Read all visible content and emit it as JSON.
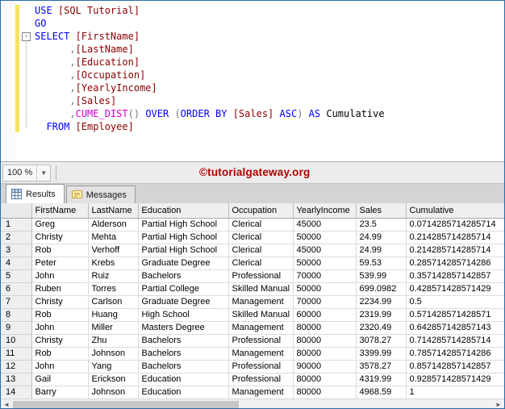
{
  "editor": {
    "token_colors": {
      "kw": "#0000ff",
      "id": "#8b0000",
      "fn": "#d400d4",
      "op": "#777777",
      "pl": "#000000"
    },
    "collapse_glyph": "-",
    "lines": [
      [
        {
          "t": "USE ",
          "c": "kw"
        },
        {
          "t": "[SQL Tutorial]",
          "c": "id"
        }
      ],
      [
        {
          "t": "GO",
          "c": "kw"
        }
      ],
      [
        {
          "t": "SELECT ",
          "c": "kw"
        },
        {
          "t": "[FirstName]",
          "c": "id"
        }
      ],
      [
        {
          "t": "      ",
          "c": "pl"
        },
        {
          "t": ",",
          "c": "op"
        },
        {
          "t": "[LastName]",
          "c": "id"
        }
      ],
      [
        {
          "t": "      ",
          "c": "pl"
        },
        {
          "t": ",",
          "c": "op"
        },
        {
          "t": "[Education]",
          "c": "id"
        }
      ],
      [
        {
          "t": "      ",
          "c": "pl"
        },
        {
          "t": ",",
          "c": "op"
        },
        {
          "t": "[Occupation]",
          "c": "id"
        }
      ],
      [
        {
          "t": "      ",
          "c": "pl"
        },
        {
          "t": ",",
          "c": "op"
        },
        {
          "t": "[YearlyIncome]",
          "c": "id"
        }
      ],
      [
        {
          "t": "      ",
          "c": "pl"
        },
        {
          "t": ",",
          "c": "op"
        },
        {
          "t": "[Sales]",
          "c": "id"
        }
      ],
      [
        {
          "t": "      ",
          "c": "pl"
        },
        {
          "t": ",",
          "c": "op"
        },
        {
          "t": "CUME_DIST",
          "c": "fn"
        },
        {
          "t": "()",
          "c": "op"
        },
        {
          "t": " ",
          "c": "pl"
        },
        {
          "t": "OVER ",
          "c": "kw"
        },
        {
          "t": "(",
          "c": "op"
        },
        {
          "t": "ORDER BY ",
          "c": "kw"
        },
        {
          "t": "[Sales]",
          "c": "id"
        },
        {
          "t": " ",
          "c": "pl"
        },
        {
          "t": "ASC",
          "c": "kw"
        },
        {
          "t": ")",
          "c": "op"
        },
        {
          "t": " ",
          "c": "pl"
        },
        {
          "t": "AS ",
          "c": "kw"
        },
        {
          "t": "Cumulative",
          "c": "pl"
        }
      ],
      [
        {
          "t": "  ",
          "c": "pl"
        },
        {
          "t": "FROM ",
          "c": "kw"
        },
        {
          "t": "[Employee]",
          "c": "id"
        }
      ]
    ]
  },
  "statusbar": {
    "zoom_value": "100 %",
    "dropdown_arrow": "▼"
  },
  "watermark": {
    "text": "©tutorialgateway.org",
    "color": "#b20000"
  },
  "results_pane": {
    "tabs": [
      {
        "label": "Results",
        "active": true
      },
      {
        "label": "Messages",
        "active": false
      }
    ],
    "grid": {
      "columns": [
        "FirstName",
        "LastName",
        "Education",
        "Occupation",
        "YearlyIncome",
        "Sales",
        "Cumulative"
      ],
      "rows": [
        [
          "Greg",
          "Alderson",
          "Partial High School",
          "Clerical",
          "45000",
          "23.5",
          "0.0714285714285714"
        ],
        [
          "Christy",
          "Mehta",
          "Partial High School",
          "Clerical",
          "50000",
          "24.99",
          "0.214285714285714"
        ],
        [
          "Rob",
          "Verhoff",
          "Partial High School",
          "Clerical",
          "45000",
          "24.99",
          "0.214285714285714"
        ],
        [
          "Peter",
          "Krebs",
          "Graduate Degree",
          "Clerical",
          "50000",
          "59.53",
          "0.285714285714286"
        ],
        [
          "John",
          "Ruiz",
          "Bachelors",
          "Professional",
          "70000",
          "539.99",
          "0.357142857142857"
        ],
        [
          "Ruben",
          "Torres",
          "Partial College",
          "Skilled Manual",
          "50000",
          "699.0982",
          "0.428571428571429"
        ],
        [
          "Christy",
          "Carlson",
          "Graduate Degree",
          "Management",
          "70000",
          "2234.99",
          "0.5"
        ],
        [
          "Rob",
          "Huang",
          "High School",
          "Skilled Manual",
          "60000",
          "2319.99",
          "0.571428571428571"
        ],
        [
          "John",
          "Miller",
          "Masters Degree",
          "Management",
          "80000",
          "2320.49",
          "0.642857142857143"
        ],
        [
          "Christy",
          "Zhu",
          "Bachelors",
          "Professional",
          "80000",
          "3078.27",
          "0.714285714285714"
        ],
        [
          "Rob",
          "Johnson",
          "Bachelors",
          "Management",
          "80000",
          "3399.99",
          "0.785714285714286"
        ],
        [
          "John",
          "Yang",
          "Bachelors",
          "Professional",
          "90000",
          "3578.27",
          "0.857142857142857"
        ],
        [
          "Gail",
          "Erickson",
          "Education",
          "Professional",
          "80000",
          "4319.99",
          "0.928571428571429"
        ],
        [
          "Barry",
          "Johnson",
          "Education",
          "Management",
          "80000",
          "4968.59",
          "1"
        ]
      ]
    }
  },
  "scrollbar": {
    "left_arrow": "◄",
    "right_arrow": "►"
  }
}
